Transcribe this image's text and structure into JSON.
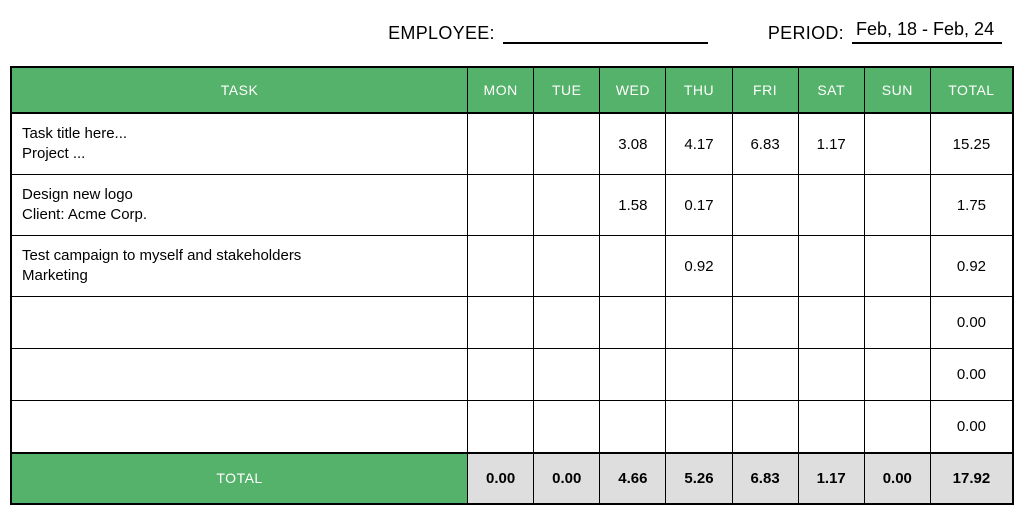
{
  "header": {
    "employee_label": "EMPLOYEE:",
    "employee_value": "",
    "period_label": "PERIOD:",
    "period_value": "Feb, 18 - Feb, 24"
  },
  "table": {
    "columns": {
      "task": "TASK",
      "days": [
        "MON",
        "TUE",
        "WED",
        "THU",
        "FRI",
        "SAT",
        "SUN"
      ],
      "total": "TOTAL"
    },
    "rows": [
      {
        "title": "Task title here...",
        "subtitle": "Project ...",
        "cells": [
          "",
          "",
          "3.08",
          "4.17",
          "6.83",
          "1.17",
          ""
        ],
        "total": "15.25"
      },
      {
        "title": "Design new logo",
        "subtitle": "Client: Acme Corp.",
        "cells": [
          "",
          "",
          "1.58",
          "0.17",
          "",
          "",
          ""
        ],
        "total": "1.75"
      },
      {
        "title": "Test campaign to myself and stakeholders",
        "subtitle": "Marketing",
        "cells": [
          "",
          "",
          "",
          "0.92",
          "",
          "",
          ""
        ],
        "total": "0.92"
      },
      {
        "title": "",
        "subtitle": "",
        "cells": [
          "",
          "",
          "",
          "",
          "",
          "",
          ""
        ],
        "total": "0.00"
      },
      {
        "title": "",
        "subtitle": "",
        "cells": [
          "",
          "",
          "",
          "",
          "",
          "",
          ""
        ],
        "total": "0.00"
      },
      {
        "title": "",
        "subtitle": "",
        "cells": [
          "",
          "",
          "",
          "",
          "",
          "",
          ""
        ],
        "total": "0.00"
      }
    ],
    "footer": {
      "label": "TOTAL",
      "cells": [
        "0.00",
        "0.00",
        "4.66",
        "5.26",
        "6.83",
        "1.17",
        "0.00"
      ],
      "grand_total": "17.92"
    }
  }
}
